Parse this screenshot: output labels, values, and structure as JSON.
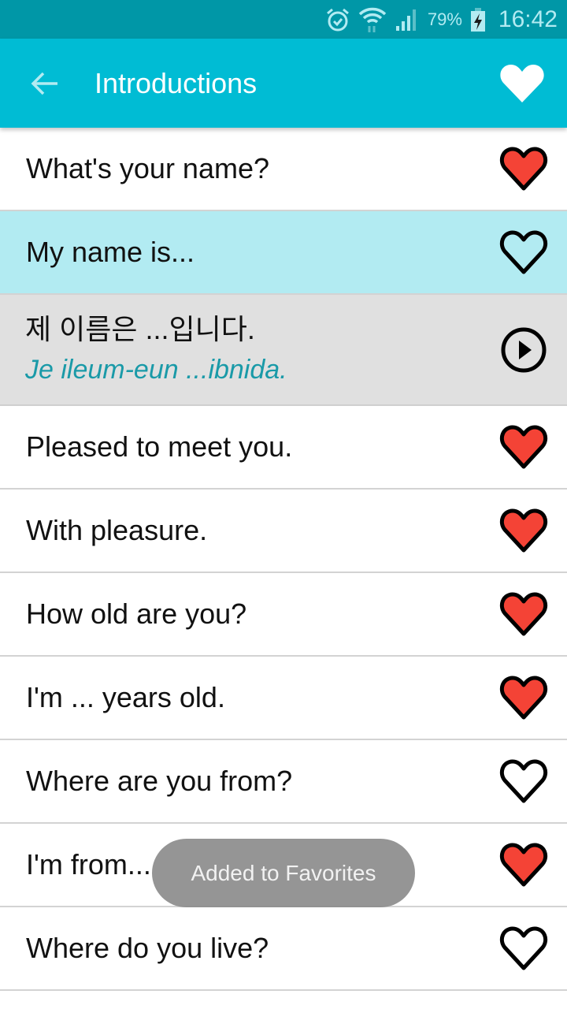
{
  "status_bar": {
    "icons": [
      "alarm-icon",
      "wifi-icon",
      "signal-icon",
      "battery-charging-icon"
    ],
    "battery_percent": "79%",
    "time": "16:42"
  },
  "app_bar": {
    "back_icon": "arrow-left-icon",
    "title": "Introductions",
    "favorite_icon": "heart-filled-icon"
  },
  "colors": {
    "status_bar": "#0097a7",
    "app_bar": "#00bcd4",
    "selected_row": "#b2ebf2",
    "detail_bg": "#e0e0e0",
    "romanization": "#1a9aa8",
    "heart_fill": "#f44336"
  },
  "phrases": [
    {
      "text": "What's your name?",
      "favorite": true
    },
    {
      "text": "My name is...",
      "favorite": false,
      "selected": true
    },
    {
      "text": "Pleased to meet you.",
      "favorite": true
    },
    {
      "text": "With pleasure.",
      "favorite": true
    },
    {
      "text": "How old are you?",
      "favorite": true
    },
    {
      "text": "I'm ... years old.",
      "favorite": true
    },
    {
      "text": "Where are you from?",
      "favorite": false
    },
    {
      "text": "I'm from...",
      "favorite": true
    },
    {
      "text": "Where do you live?",
      "favorite": false
    }
  ],
  "detail": {
    "korean": "제 이름은 ...입니다.",
    "romanization": "Je ileum-eun ...ibnida.",
    "play_icon": "play-circle-icon"
  },
  "toast": {
    "message": "Added to Favorites"
  }
}
